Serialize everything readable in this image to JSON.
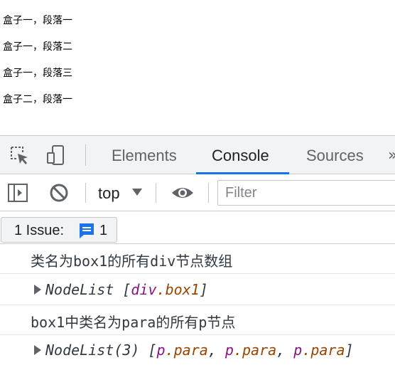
{
  "page": {
    "paragraphs": [
      "盒子一，段落一",
      "盒子一，段落二",
      "盒子一，段落三",
      "盒子二，段落一"
    ]
  },
  "devtools": {
    "tabs": [
      "Elements",
      "Console",
      "Sources"
    ],
    "active_tab": "Console",
    "more_tabs_glyph": "»",
    "icons": {
      "inspect": "inspect-element-icon",
      "device": "device-toolbar-icon",
      "sidebar": "console-sidebar-icon",
      "clear": "clear-console-icon",
      "eye": "live-expression-eye-icon",
      "issue": "issue-message-icon"
    },
    "toolbar": {
      "context": "top",
      "filter_placeholder": "Filter"
    },
    "issues": {
      "label": "1 Issue:",
      "count": "1"
    },
    "console": {
      "log1": "类名为box1的所有div节点数组",
      "node1_name": "NodeList",
      "node1_open": " [",
      "node1_el": "div",
      "node1_cls": ".box1",
      "node1_close": "]",
      "log2": "box1中类名为para的所有p节点",
      "node2_name": "NodeList(3)",
      "node2_open": " [",
      "node2_el1": "p",
      "node2_cls1": ".para",
      "node2_sep1": ", ",
      "node2_el2": "p",
      "node2_cls2": ".para",
      "node2_sep2": ", ",
      "node2_el3": "p",
      "node2_cls3": ".para",
      "node2_close": "]"
    },
    "colors": {
      "accent": "#1a73e8",
      "element_tag": "#881280",
      "class_name": "#994500"
    }
  }
}
